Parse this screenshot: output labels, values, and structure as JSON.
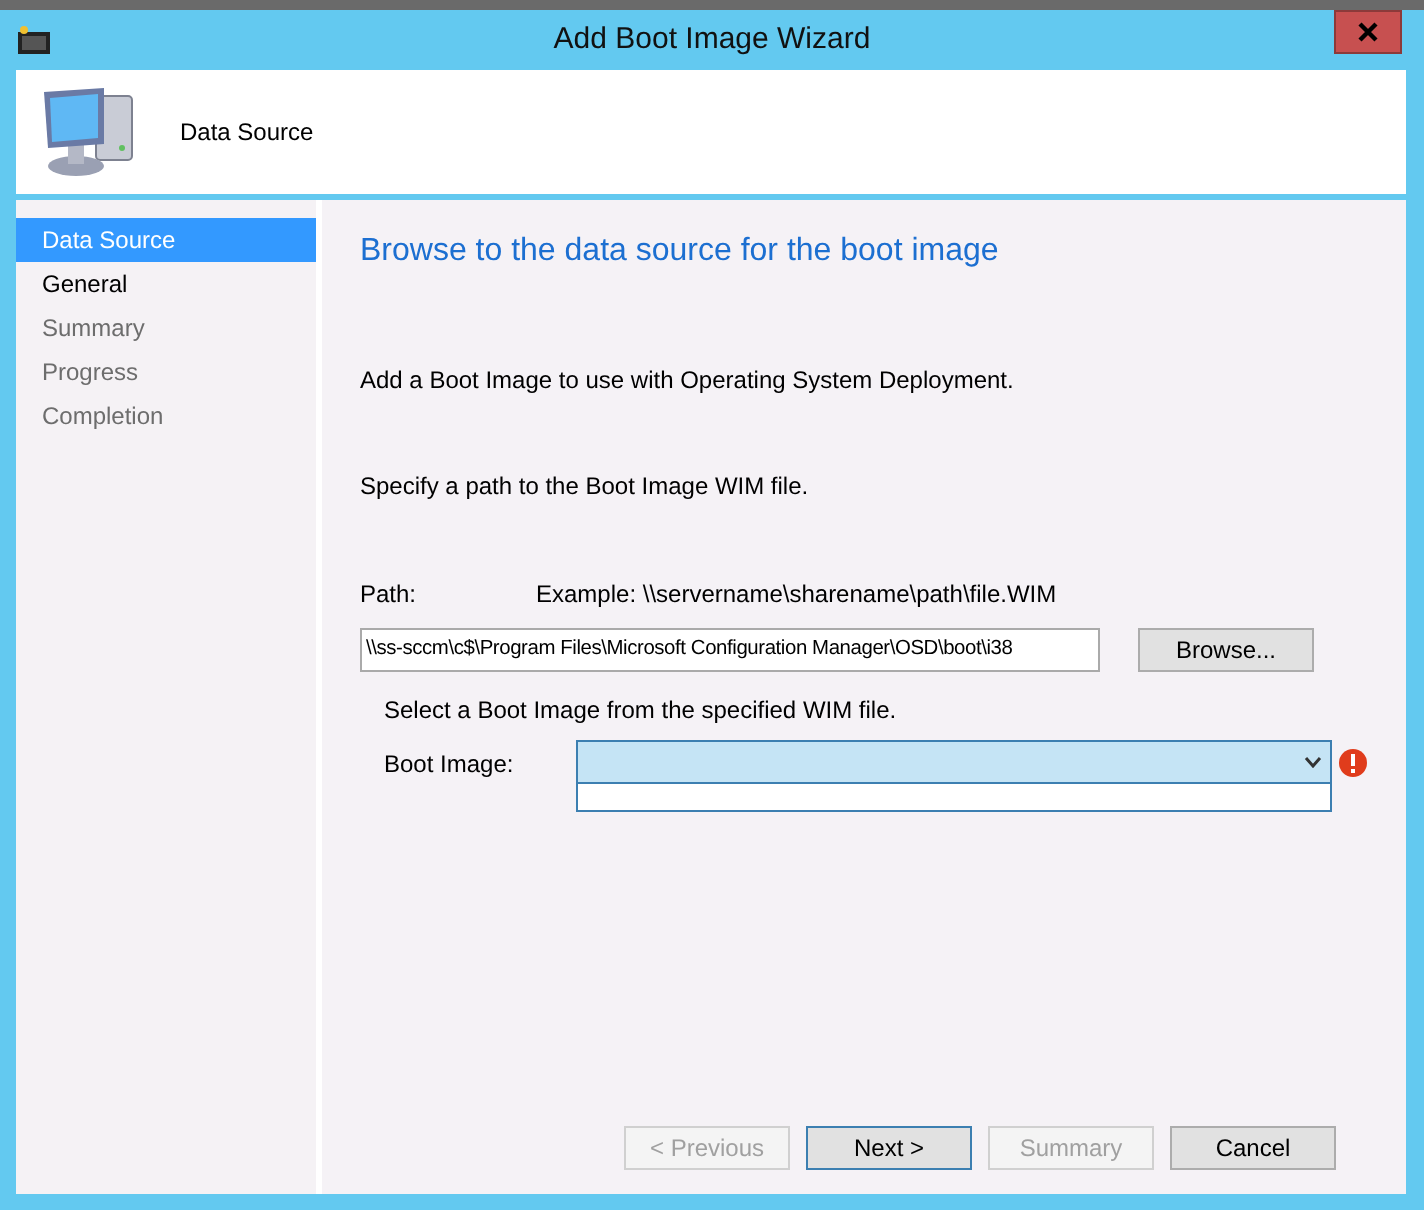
{
  "window": {
    "title": "Add Boot Image Wizard"
  },
  "header": {
    "title": "Data Source"
  },
  "steps": [
    {
      "label": "Data Source",
      "selected": true,
      "disabled": false
    },
    {
      "label": "General",
      "selected": false,
      "disabled": false
    },
    {
      "label": "Summary",
      "selected": false,
      "disabled": true
    },
    {
      "label": "Progress",
      "selected": false,
      "disabled": true
    },
    {
      "label": "Completion",
      "selected": false,
      "disabled": true
    }
  ],
  "page": {
    "heading": "Browse to the data source for the boot image",
    "intro": "Add a Boot Image to use with Operating System Deployment.",
    "path_instruction": "Specify a path to the Boot Image WIM file.",
    "path_label": "Path:",
    "path_example": "Example: \\\\servername\\sharename\\path\\file.WIM",
    "path_value": "\\\\ss-sccm\\c$\\Program Files\\Microsoft Configuration Manager\\OSD\\boot\\i38",
    "browse_button": "Browse...",
    "select_instruction": "Select a Boot Image from the specified WIM file.",
    "boot_image_label": "Boot Image:",
    "boot_image_error": true
  },
  "buttons": [
    {
      "label": "< Previous",
      "disabled": true,
      "default": false
    },
    {
      "label": "Next >",
      "disabled": false,
      "default": true
    },
    {
      "label": "Summary",
      "disabled": true,
      "default": false
    },
    {
      "label": "Cancel",
      "disabled": false,
      "default": false
    }
  ]
}
